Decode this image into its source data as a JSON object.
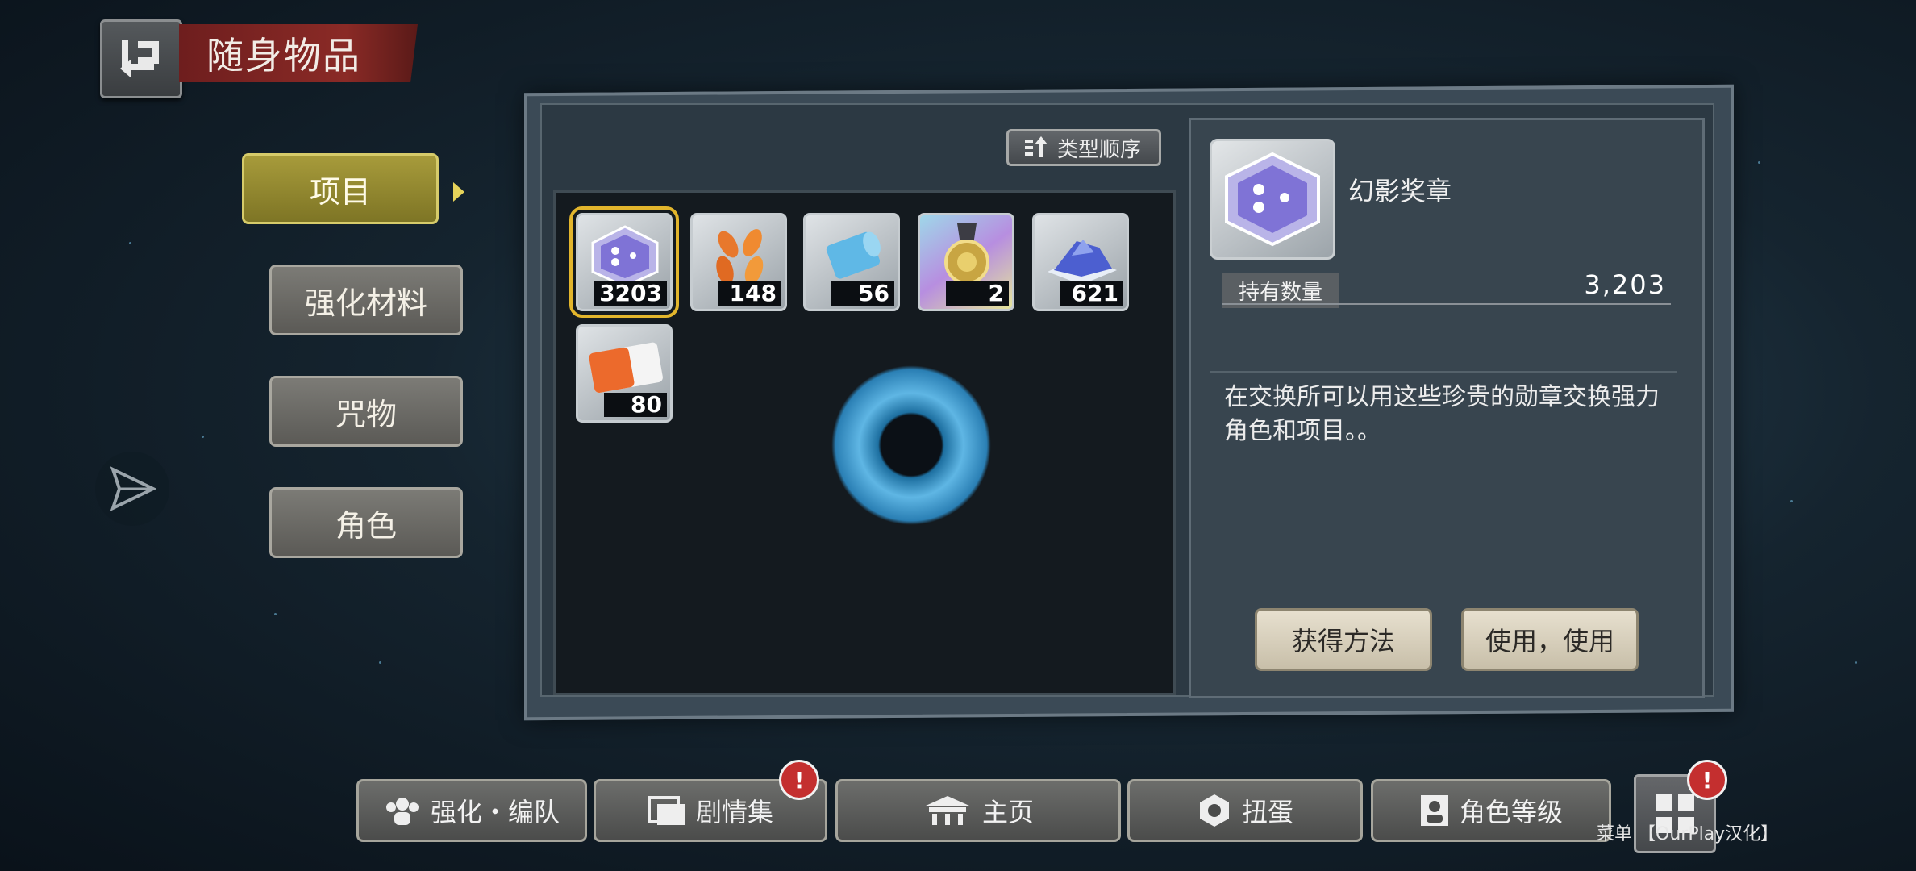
{
  "header": {
    "title": "随身物品",
    "back_icon": "back-arrow-icon"
  },
  "tabs": [
    {
      "label": "项目",
      "active": true
    },
    {
      "label": "强化材料",
      "active": false
    },
    {
      "label": "咒物",
      "active": false
    },
    {
      "label": "角色",
      "active": false
    }
  ],
  "sort": {
    "label": "类型顺序",
    "icon": "sort-icon"
  },
  "items": [
    {
      "name": "phantom-medal",
      "count": "3203",
      "selected": true
    },
    {
      "name": "orange-petals",
      "count": "148"
    },
    {
      "name": "blue-scroll",
      "count": "56"
    },
    {
      "name": "gold-medal",
      "count": "2"
    },
    {
      "name": "blue-crystal-pile",
      "count": "621"
    },
    {
      "name": "orange-ticket",
      "count": "80"
    }
  ],
  "detail": {
    "name": "幻影奖章",
    "qty_label": "持有数量",
    "qty_value": "3,203",
    "description": "在交换所可以用这些珍贵的勋章交换强力角色和项目。。",
    "btn_obtain": "获得方法",
    "btn_use": "使用，使用"
  },
  "bottom_nav": [
    {
      "label": "强化・编队",
      "icon": "team-icon",
      "alert": false
    },
    {
      "label": "剧情集",
      "icon": "story-icon",
      "alert": true
    },
    {
      "label": "主页",
      "icon": "home-icon",
      "alert": false
    },
    {
      "label": "扭蛋",
      "icon": "gacha-icon",
      "alert": false
    },
    {
      "label": "角色等级",
      "icon": "character-icon",
      "alert": false
    }
  ],
  "menu": {
    "label": "菜单",
    "watermark": "【OurPlay汉化】",
    "alert": true,
    "alert_symbol": "!"
  },
  "colors": {
    "accent_gold": "#d6cb6a",
    "title_red": "#8a2a26",
    "alert_red": "#c42f2f"
  }
}
